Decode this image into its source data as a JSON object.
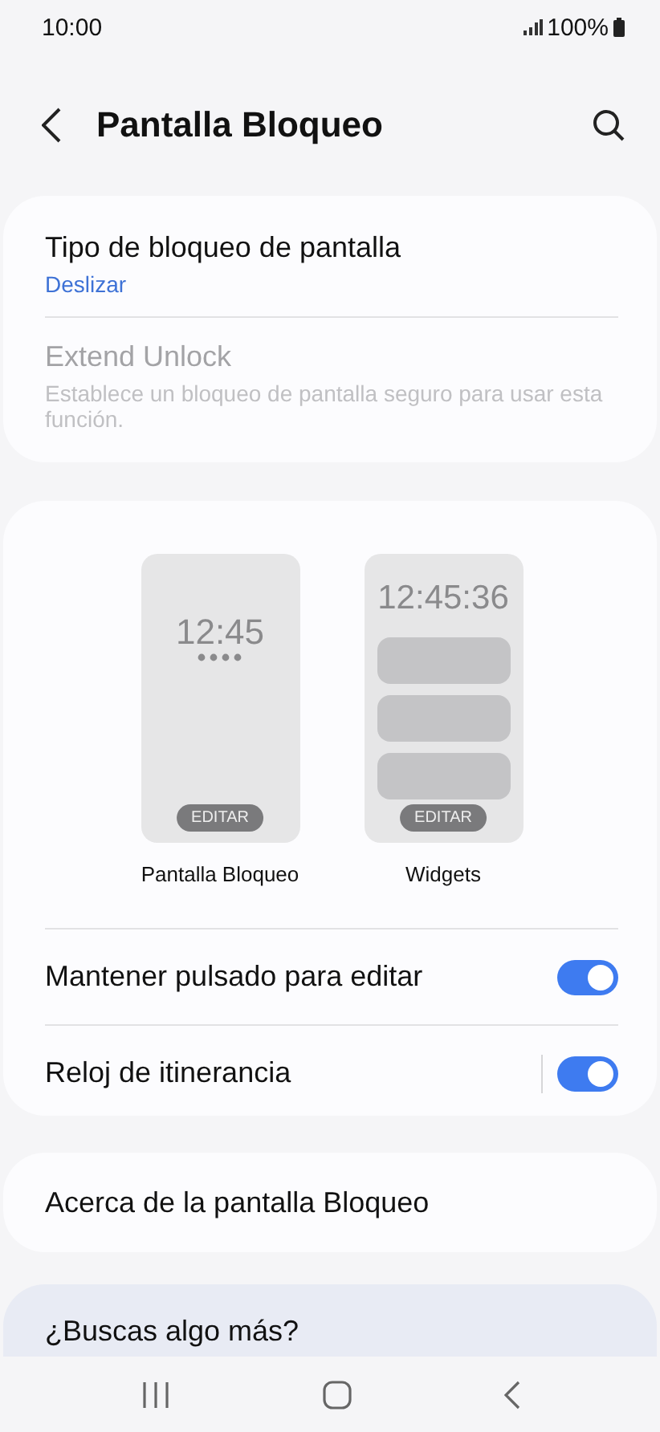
{
  "status_bar": {
    "time": "10:00",
    "battery": "100%"
  },
  "header": {
    "title": "Pantalla Bloqueo"
  },
  "lock_settings": [
    {
      "title": "Tipo de bloqueo de pantalla",
      "subtitle": "Deslizar",
      "disabled": false
    },
    {
      "title": "Extend Unlock",
      "subtitle": "Establece un bloqueo de pantalla seguro para usar esta función.",
      "disabled": true
    }
  ],
  "previews": [
    {
      "kind": "lock",
      "clock": "12:45",
      "button": "EDITAR",
      "caption": "Pantalla Bloqueo"
    },
    {
      "kind": "widgets",
      "clock": "12:45:36",
      "button": "EDITAR",
      "caption": "Widgets"
    }
  ],
  "toggles": [
    {
      "label": "Mantener pulsado para editar",
      "on": true,
      "divider": false
    },
    {
      "label": "Reloj de itinerancia",
      "on": true,
      "divider": true
    }
  ],
  "about": {
    "label": "Acerca de la pantalla Bloqueo"
  },
  "help": {
    "title": "¿Buscas algo más?"
  }
}
